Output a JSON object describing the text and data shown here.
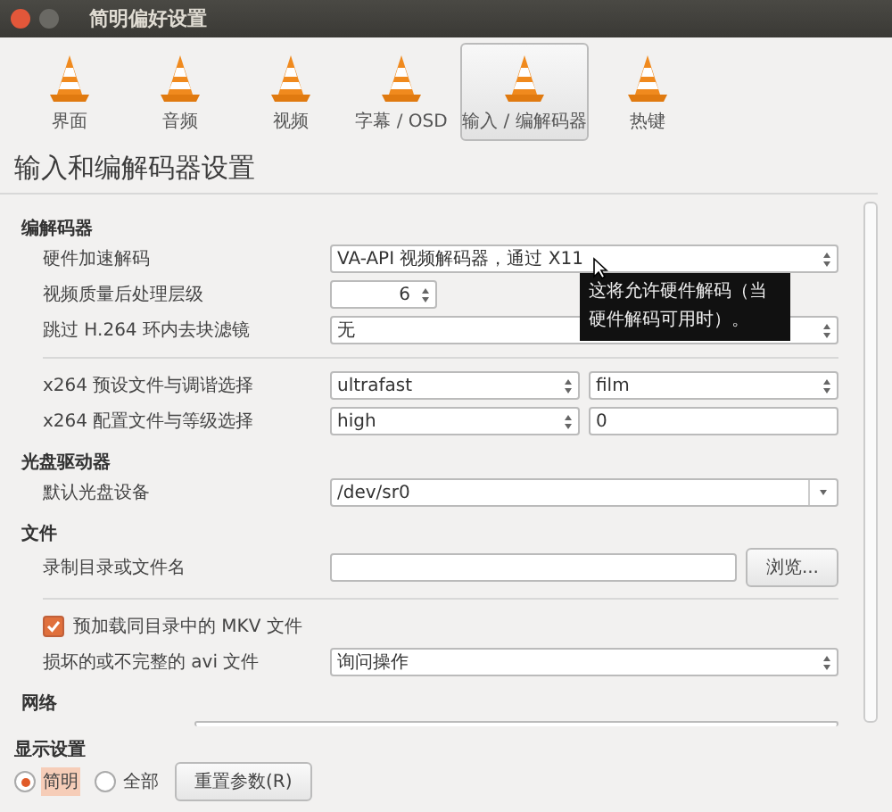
{
  "window": {
    "title": "简明偏好设置"
  },
  "tabs": [
    {
      "label": "界面",
      "selected": false
    },
    {
      "label": "音频",
      "selected": false
    },
    {
      "label": "视频",
      "selected": false
    },
    {
      "label": "字幕 / OSD",
      "selected": false
    },
    {
      "label": "输入 / 编解码器",
      "selected": true
    },
    {
      "label": "热键",
      "selected": false
    }
  ],
  "heading": "输入和编解码器设置",
  "sections": [
    {
      "title": "编解码器",
      "rows": [
        {
          "kind": "select",
          "label": "硬件加速解码",
          "value": "VA-API 视频解码器，通过 X11"
        },
        {
          "kind": "spin",
          "label": "视频质量后处理层级",
          "value": "6"
        },
        {
          "kind": "select",
          "label": "跳过 H.264 环内去块滤镜",
          "value": "无"
        },
        {
          "kind": "divider"
        },
        {
          "kind": "pair",
          "label": "x264 预设文件与调谐选择",
          "first": "ultrafast",
          "second": {
            "kind": "select",
            "value": "film"
          }
        },
        {
          "kind": "pair",
          "label": "x264 配置文件与等级选择",
          "first": "high",
          "second": {
            "kind": "text",
            "value": "0"
          }
        }
      ]
    },
    {
      "title": "光盘驱动器",
      "rows": [
        {
          "kind": "combo",
          "label": "默认光盘设备",
          "value": "/dev/sr0"
        }
      ]
    },
    {
      "title": "文件",
      "rows": [
        {
          "kind": "path",
          "label": "录制目录或文件名",
          "button": "浏览..."
        },
        {
          "kind": "divider"
        },
        {
          "kind": "checkbox",
          "label": "预加载同目录中的 MKV 文件",
          "checked": true
        },
        {
          "kind": "select",
          "label": "损坏的或不完整的 avi 文件",
          "value": "询问操作"
        }
      ]
    },
    {
      "title": "网络",
      "rows": [
        {
          "kind": "cut"
        }
      ]
    }
  ],
  "tooltip": "这将允许硬件解码（当硬件解码可用时）。",
  "display": {
    "title": "显示设置",
    "options": [
      {
        "label": "简明",
        "selected": true
      },
      {
        "label": "全部",
        "selected": false
      }
    ],
    "reset_button": "重置参数(R)"
  }
}
